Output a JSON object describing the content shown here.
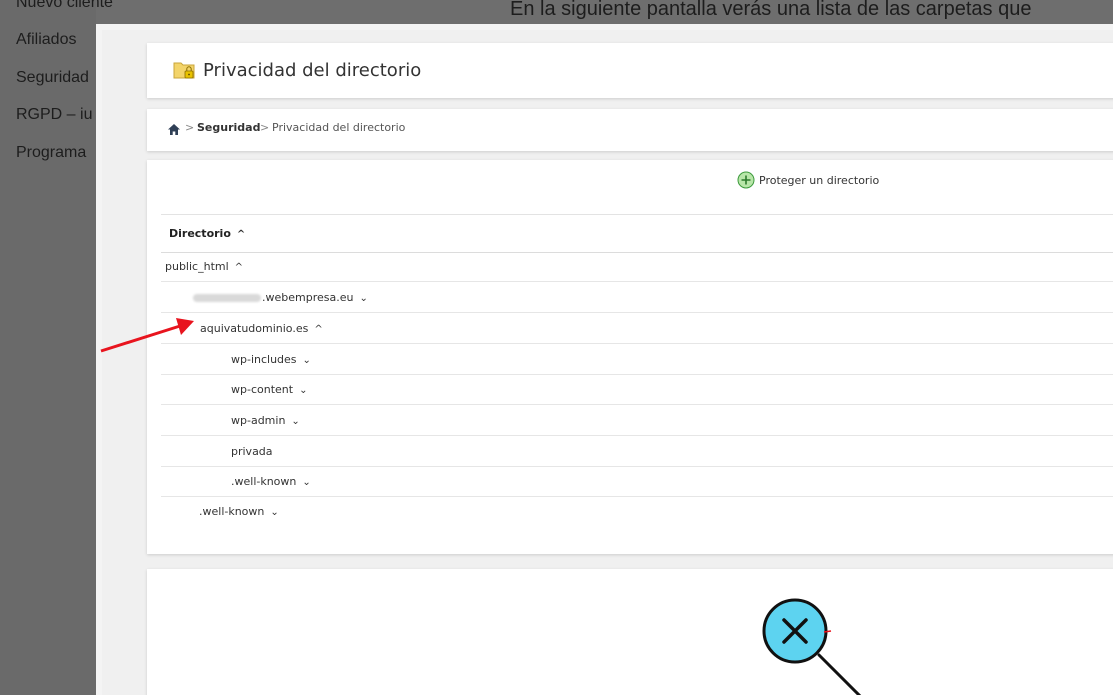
{
  "background": {
    "heading": "En la siguiente pantalla verás una lista de las carpetas que",
    "menu": [
      "Nuevo cliente",
      "Afiliados",
      "Seguridad",
      "RGPD – iu",
      "Programa"
    ]
  },
  "header": {
    "title": "Privacidad del directorio"
  },
  "breadcrumb": {
    "section": "Seguridad",
    "current": "Privacidad del directorio",
    "sep": ">"
  },
  "actions": {
    "protect_label": "Proteger un directorio"
  },
  "table": {
    "column": "Directorio",
    "rows": [
      {
        "label": "public_html",
        "toggle": "^"
      },
      {
        "label": ".webempresa.eu",
        "toggle": "v",
        "redacted_prefix": true
      },
      {
        "label": "aquivatudominio.es",
        "toggle": "^"
      },
      {
        "label": "wp-includes",
        "toggle": "v"
      },
      {
        "label": "wp-content",
        "toggle": "v"
      },
      {
        "label": "wp-admin",
        "toggle": "v"
      },
      {
        "label": "privada",
        "toggle": ""
      },
      {
        "label": ".well-known",
        "toggle": "v"
      },
      {
        "label": ".well-known",
        "toggle": "v"
      }
    ]
  },
  "colors": {
    "annotation_arrow": "#e8141e",
    "accent_green": "#3c9a3c",
    "magnifier_fill": "#5dd3f0"
  }
}
